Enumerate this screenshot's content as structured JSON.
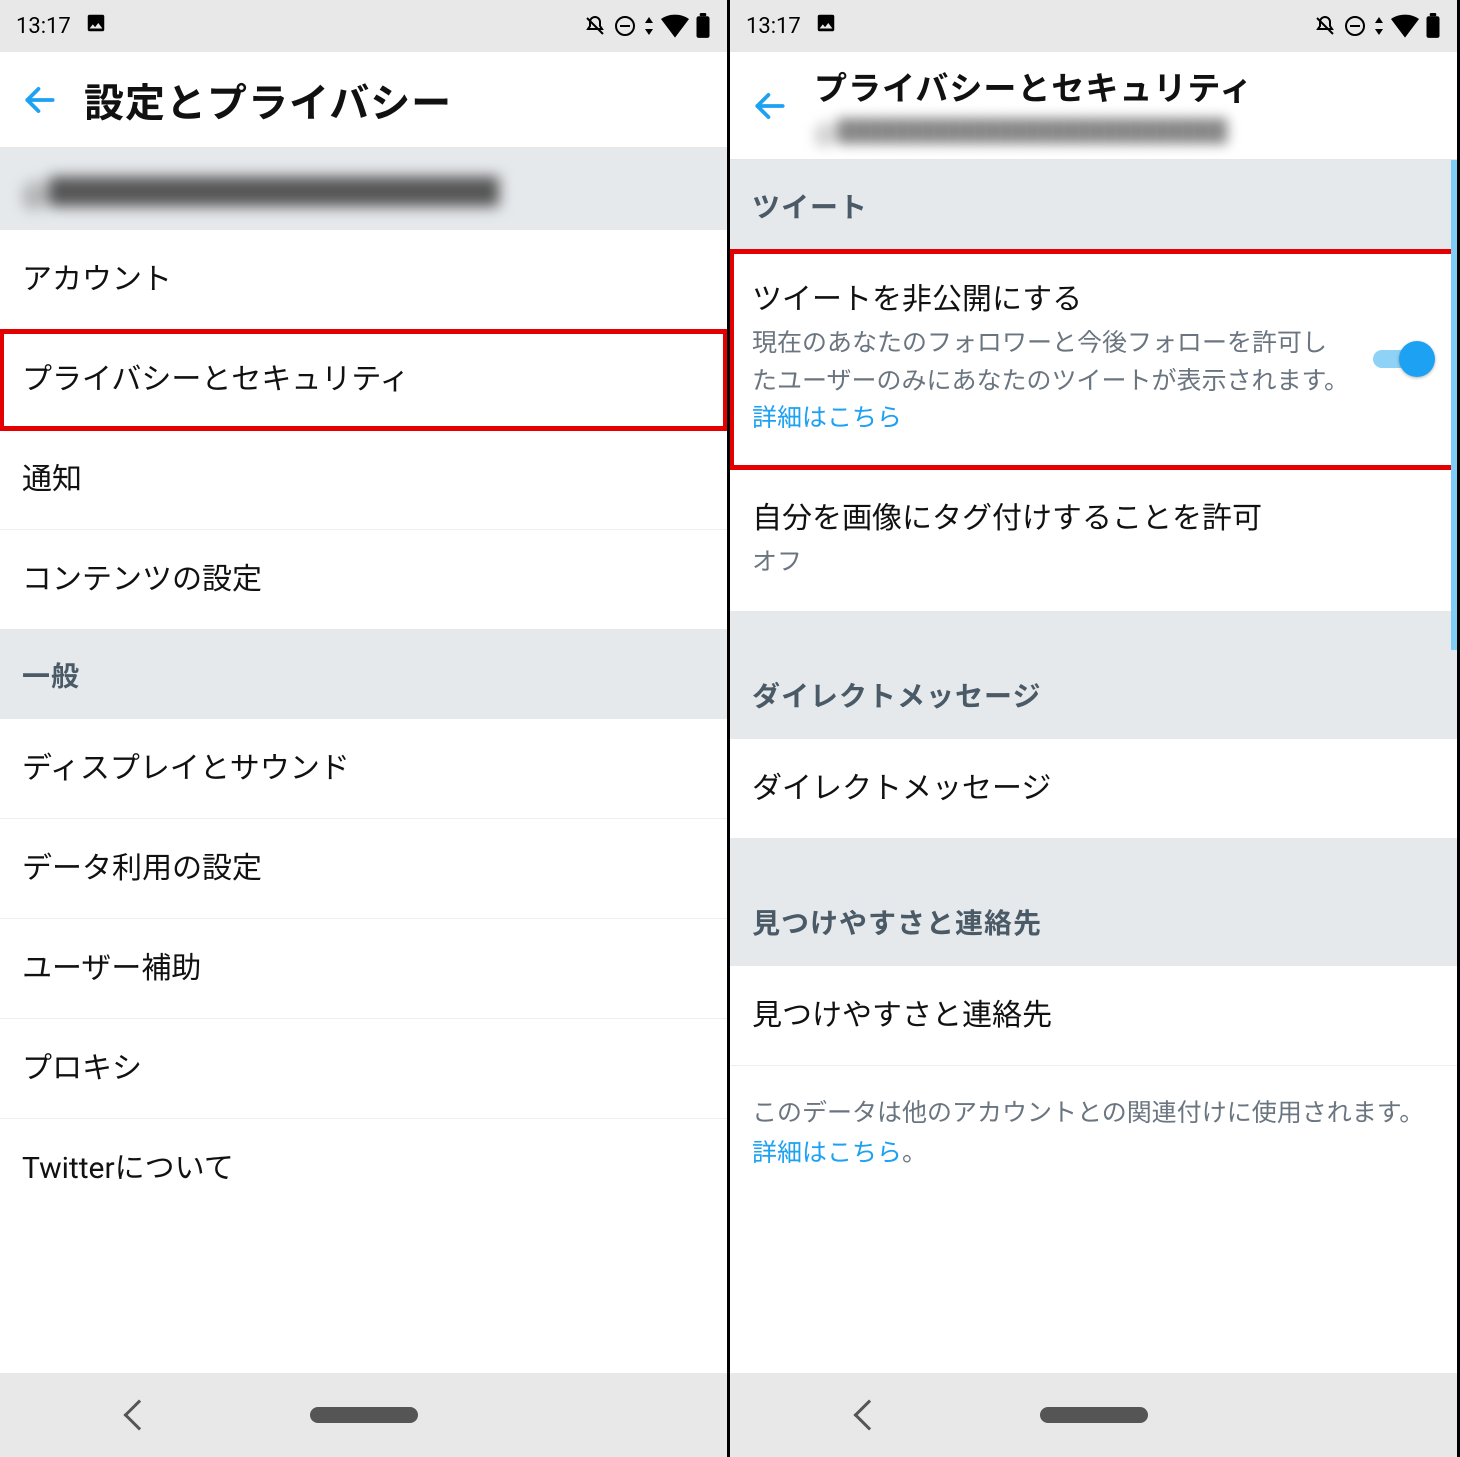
{
  "status": {
    "time": "13:17"
  },
  "left": {
    "title": "設定とプライバシー",
    "account_handle": "@███████████████",
    "items": [
      "アカウント",
      "プライバシーとセキュリティ",
      "通知",
      "コンテンツの設定"
    ],
    "general_header": "一般",
    "general_items": [
      "ディスプレイとサウンド",
      "データ利用の設定",
      "ユーザー補助",
      "プロキシ",
      "Twitterについて"
    ]
  },
  "right": {
    "title": "プライバシーとセキュリティ",
    "subtitle": "@███████████████",
    "section_tweet": "ツイート",
    "protect": {
      "title": "ツイートを非公開にする",
      "desc_pre": "現在のあなたのフォロワーと今後フォローを許可したユーザーのみにあなたのツイートが表示されます。",
      "desc_link": "詳細はこちら",
      "on": true
    },
    "tagging": {
      "title": "自分を画像にタグ付けすることを許可",
      "sub": "オフ"
    },
    "section_dm": "ダイレクトメッセージ",
    "dm_item": "ダイレクトメッセージ",
    "section_discover": "見つけやすさと連絡先",
    "discover_item": "見つけやすさと連絡先",
    "discover_note_pre": "このデータは他のアカウントとの関連付けに使用されます。",
    "discover_note_link": "詳細はこちら",
    "discover_note_post": "。"
  }
}
